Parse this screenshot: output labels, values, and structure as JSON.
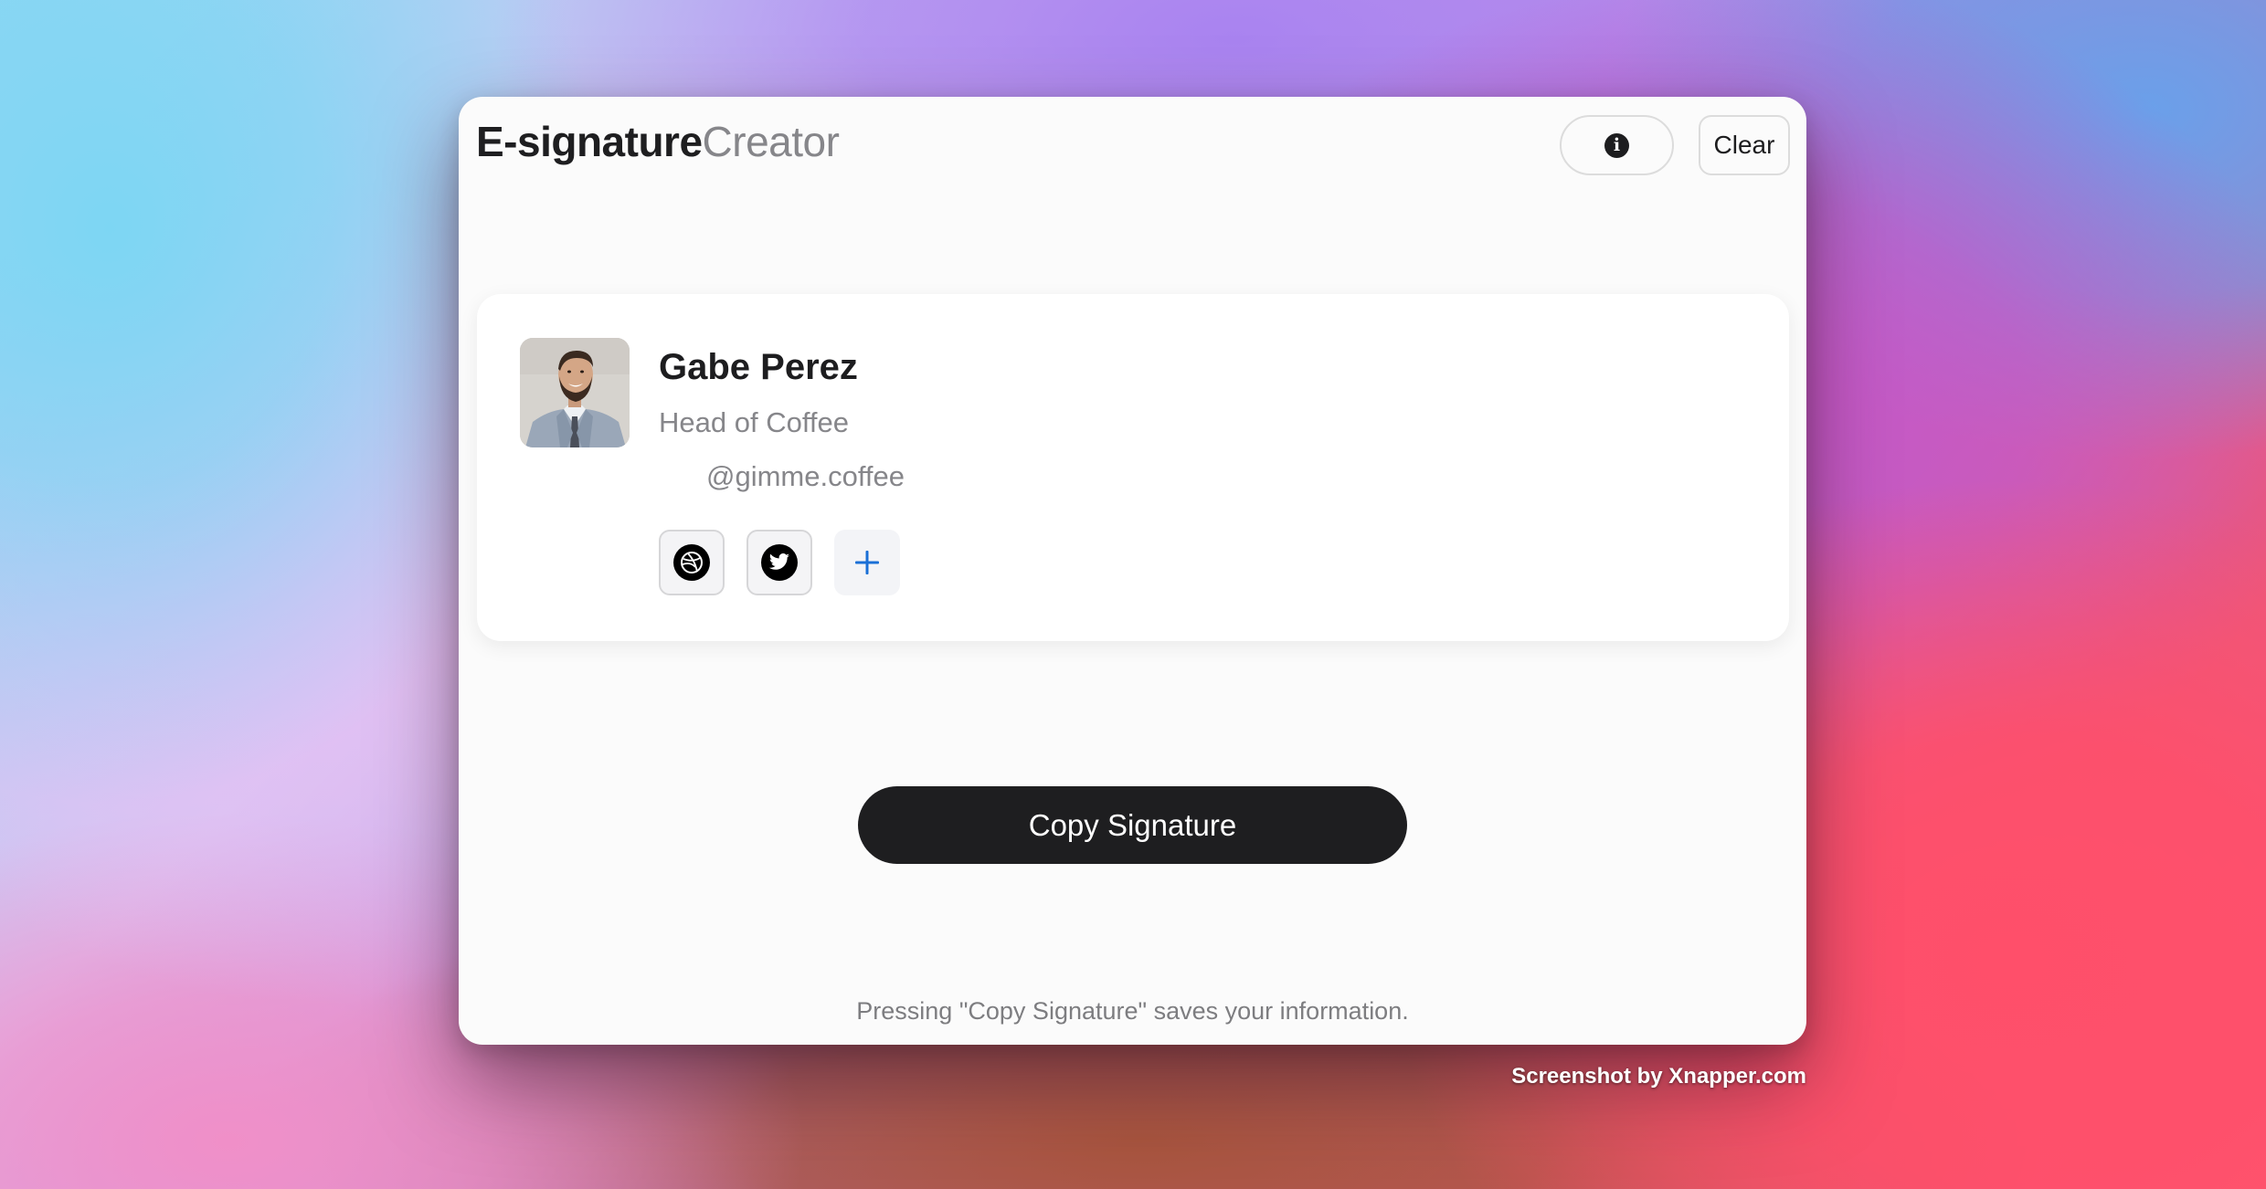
{
  "app": {
    "title_bold": "E-signature",
    "title_light": "Creator"
  },
  "header": {
    "info_icon": "info-icon",
    "clear_label": "Clear"
  },
  "signature": {
    "avatar": "profile-photo",
    "name": "Gabe Perez",
    "role": "Head of Coffee",
    "handle": "@gimme.coffee",
    "social_links": [
      {
        "icon": "dribbble-icon"
      },
      {
        "icon": "twitter-icon"
      }
    ],
    "add_link_icon": "plus-icon"
  },
  "actions": {
    "copy_label": "Copy Signature"
  },
  "footer": {
    "note": "Pressing \"Copy Signature\" saves your information."
  },
  "watermark": "Screenshot by Xnapper.com",
  "colors": {
    "primary_button": "#1e1e20",
    "muted_text": "#86868a",
    "accent_plus": "#1a6fd6",
    "window_bg": "#fbfbfb"
  }
}
